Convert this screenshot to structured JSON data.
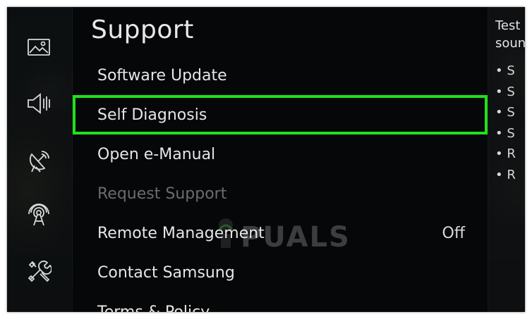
{
  "menu": {
    "title": "Support",
    "items": [
      {
        "label": "Software Update",
        "value": ""
      },
      {
        "label": "Self Diagnosis",
        "value": "",
        "selected": true
      },
      {
        "label": "Open e-Manual",
        "value": ""
      },
      {
        "label": "Request Support",
        "value": "",
        "disabled": true
      },
      {
        "label": "Remote Management",
        "value": "Off"
      },
      {
        "label": "Contact Samsung",
        "value": ""
      },
      {
        "label": "Terms & Policy",
        "value": ""
      }
    ],
    "highlight_color": "#22e01c"
  },
  "sidebar": {
    "icons": [
      "picture-icon",
      "sound-icon",
      "broadcasting-icon",
      "network-icon",
      "support-tools-icon"
    ]
  },
  "help": {
    "line1": "Test",
    "line2": "soun",
    "bullets": [
      "S",
      "S",
      "S",
      "S",
      "R",
      "R"
    ]
  },
  "watermark": {
    "text": "PUALS"
  }
}
